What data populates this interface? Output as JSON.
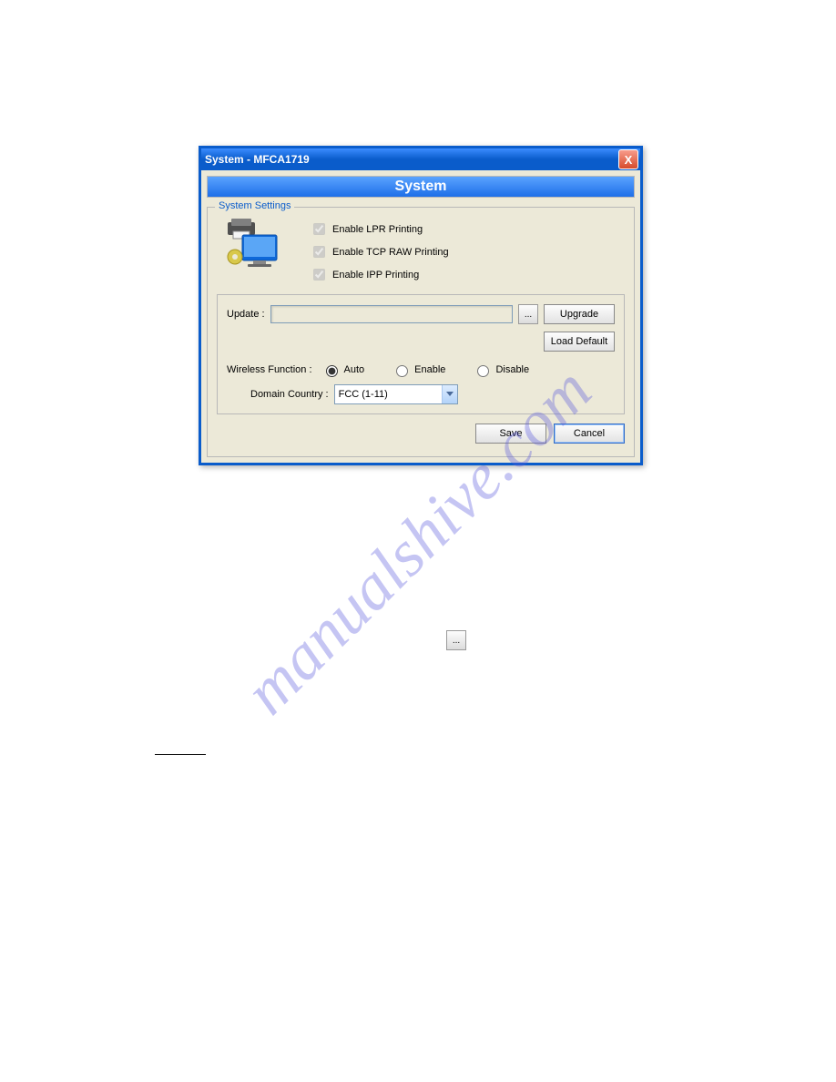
{
  "watermark": "manualshive.com",
  "window": {
    "title": "System - MFCA1719",
    "close_x": "X"
  },
  "banner": "System",
  "groupbox_label": "System Settings",
  "checks": {
    "lpr": "Enable LPR Printing",
    "tcp": "Enable TCP RAW Printing",
    "ipp": "Enable IPP Printing"
  },
  "update_label": "Update :",
  "browse_dots": "...",
  "buttons": {
    "upgrade": "Upgrade",
    "load_default": "Load Default",
    "save": "Save",
    "cancel": "Cancel"
  },
  "wireless_label": "Wireless Function :",
  "radios": {
    "auto": "Auto",
    "enable": "Enable",
    "disable": "Disable"
  },
  "domain_label": "Domain Country :",
  "domain_value": "FCC (1-11)"
}
